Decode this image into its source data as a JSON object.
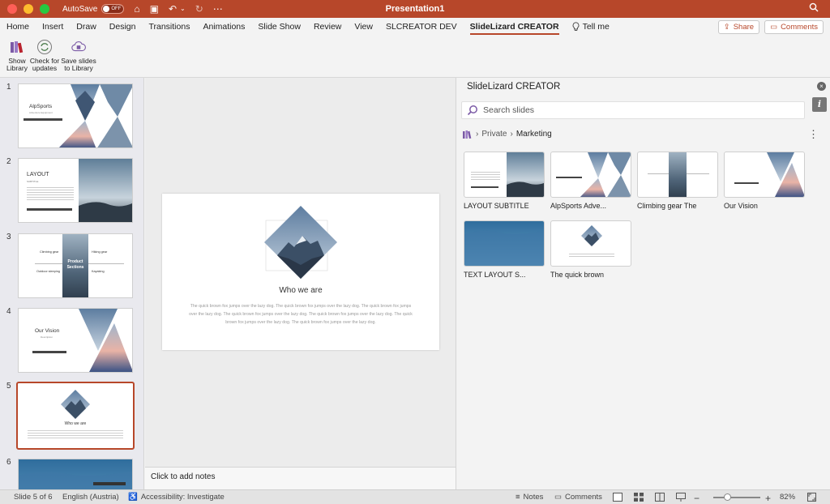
{
  "titlebar": {
    "autosave_label": "AutoSave",
    "autosave_state": "OFF",
    "title": "Presentation1"
  },
  "tabs": [
    {
      "label": "Home"
    },
    {
      "label": "Insert"
    },
    {
      "label": "Draw"
    },
    {
      "label": "Design"
    },
    {
      "label": "Transitions"
    },
    {
      "label": "Animations"
    },
    {
      "label": "Slide Show"
    },
    {
      "label": "Review"
    },
    {
      "label": "View"
    },
    {
      "label": "SLCREATOR DEV"
    },
    {
      "label": "SlideLizard CREATOR",
      "active": true
    }
  ],
  "tellme": "Tell me",
  "ribbon_right": {
    "share": "Share",
    "comments": "Comments"
  },
  "ribbon": {
    "show_library": "Show Library",
    "check_updates": "Check for updates",
    "save_slides": "Save slides to Library"
  },
  "thumbnails": {
    "numbers": [
      "1",
      "2",
      "3",
      "4",
      "5",
      "6"
    ],
    "selected": 5,
    "s1": {
      "title": "AlpSports",
      "sub": "Adventure Equipment"
    },
    "s2": {
      "title": "LAYOUT",
      "sub": "SUBTITLE"
    },
    "s3": {
      "left1": "Climbing gear",
      "left2": "Outdoor sleeping",
      "center1": "Product",
      "center2": "Sections",
      "right1": "Hiking gear",
      "right2": "Kayaking"
    },
    "s4": {
      "title": "Our Vision",
      "sub": "Description"
    },
    "s5": {
      "title": "Who we are"
    }
  },
  "slide": {
    "heading": "Who we are",
    "body": "The quick brown fox jumps over the lazy dog. The quick brown fox jumps over the lazy dog. The quick brown fox jumps over the lazy dog. The quick brown fox jumps over the lazy dog. The quick brown fox jumps over the lazy dog. The quick brown fox jumps over the lazy dog. The quick brown fox jumps over the lazy dog."
  },
  "notes_placeholder": "Click to add notes",
  "panel": {
    "title": "SlideLizard CREATOR",
    "search_placeholder": "Search slides",
    "breadcrumb": {
      "root": "Private",
      "current": "Marketing"
    },
    "cards": [
      {
        "label": "LAYOUT SUBTITLE"
      },
      {
        "label": "AlpSports Adve..."
      },
      {
        "label": "Climbing gear The"
      },
      {
        "label": "Our Vision"
      },
      {
        "label": "TEXT LAYOUT S..."
      },
      {
        "label": "The quick brown"
      }
    ]
  },
  "statusbar": {
    "slide_info": "Slide 5 of 6",
    "language": "English (Austria)",
    "accessibility": "Accessibility: Investigate",
    "notes": "Notes",
    "comments": "Comments",
    "zoom": "82%"
  },
  "colors": {
    "accent": "#b7472a",
    "panel_bg": "#f3f3f3"
  }
}
